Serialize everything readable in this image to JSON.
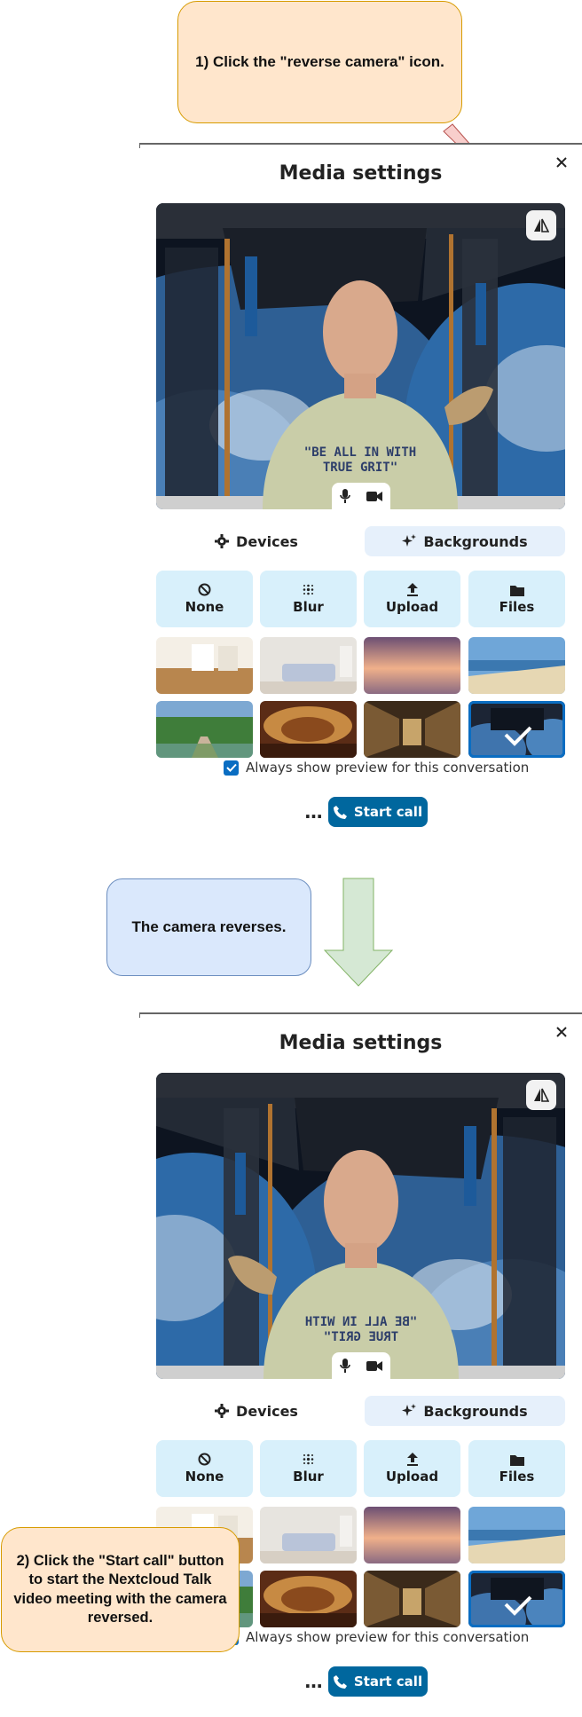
{
  "callouts": {
    "step1": "1) Click the \"reverse camera\" icon.",
    "middle": "The camera reverses.",
    "step2": "2) Click the \"Start call\" button to start the Nextcloud Talk video meeting with the camera reversed."
  },
  "dialog": {
    "title": "Media settings",
    "tabs": {
      "devices": "Devices",
      "backgrounds": "Backgrounds"
    },
    "background_buttons": [
      "None",
      "Blur",
      "Upload",
      "Files"
    ],
    "thumbnails": [
      "office-room",
      "living-room-sofa",
      "sunset-gradient",
      "beach",
      "japanese-garden",
      "theater",
      "library",
      "space-station"
    ],
    "selected_thumbnail": "space-station",
    "always_preview_label": "Always show preview for this conversation",
    "always_preview_checked": true,
    "more_label": "…",
    "start_call_label": "Start call"
  },
  "preview": {
    "shirt_text_line1": "\"BE ALL IN WITH",
    "shirt_text_line2": "TRUE GRIT\""
  },
  "colors": {
    "primary": "#00679e",
    "selected_outline": "#0a6dc2",
    "callout_orange_bg": "#ffe6cc",
    "callout_blue_bg": "#dae8fc",
    "arrow_red": "#f8cecc",
    "arrow_green": "#d5e8d4"
  },
  "icons": [
    "close-icon",
    "mirror-camera-icon",
    "microphone-icon",
    "video-camera-icon",
    "gear-icon",
    "sparkles-icon",
    "none-icon",
    "blur-icon",
    "upload-icon",
    "folder-icon",
    "checkmark-icon",
    "phone-icon"
  ]
}
